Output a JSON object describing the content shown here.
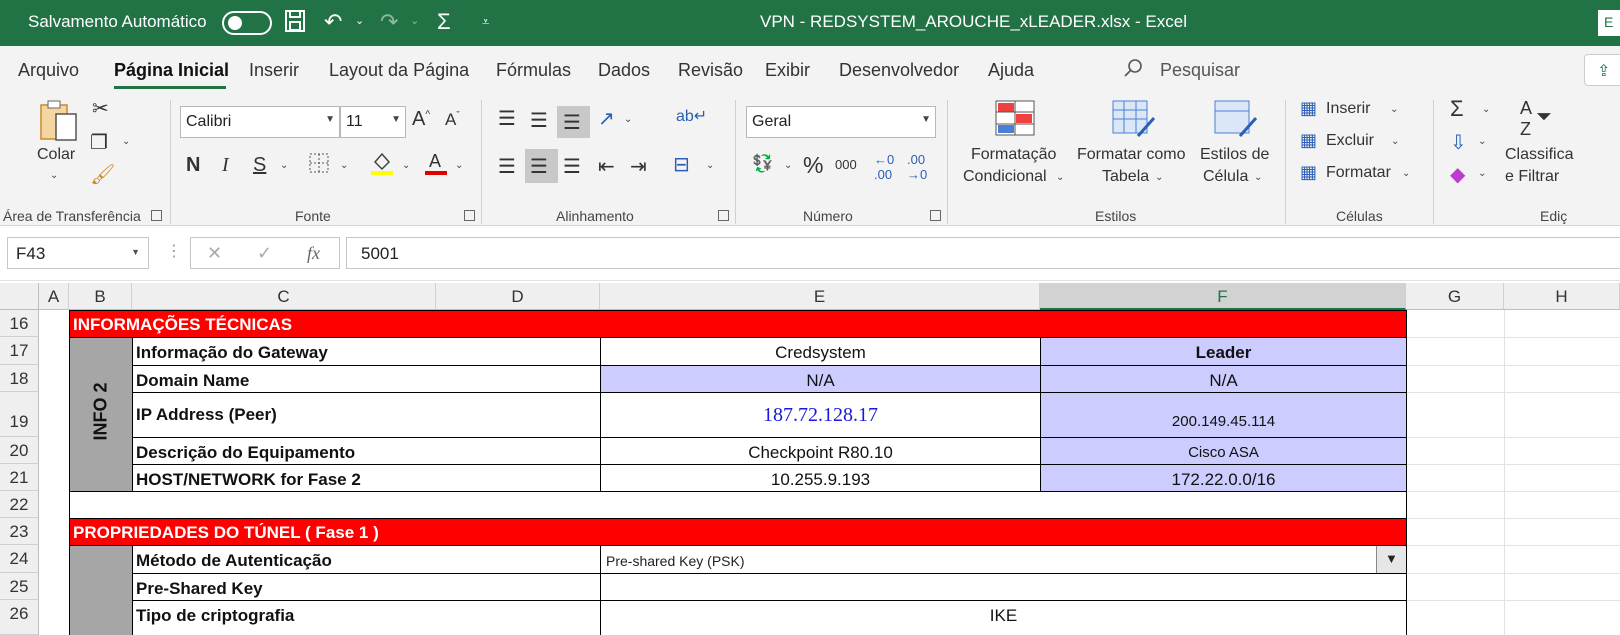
{
  "titlebar": {
    "autosave_label": "Salvamento Automático",
    "doc_title": "VPN  -  REDSYSTEM_AROUCHE_xLEADER.xlsx  -  Excel",
    "right_badge": "E"
  },
  "tabs": {
    "items": [
      "Arquivo",
      "Página Inicial",
      "Inserir",
      "Layout da Página",
      "Fórmulas",
      "Dados",
      "Revisão",
      "Exibir",
      "Desenvolvedor",
      "Ajuda"
    ],
    "search_label": "Pesquisar"
  },
  "ribbon": {
    "clipboard": {
      "paste_label": "Colar",
      "group_label": "Área de Transferência"
    },
    "font": {
      "font_name": "Calibri",
      "font_size": "11",
      "bold": "N",
      "italic": "I",
      "underline": "S",
      "group_label": "Fonte"
    },
    "alignment": {
      "group_label": "Alinhamento"
    },
    "number": {
      "format": "Geral",
      "group_label": "Número"
    },
    "styles": {
      "cond_format_line1": "Formatação",
      "cond_format_line2": "Condicional",
      "format_table_line1": "Formatar como",
      "format_table_line2": "Tabela",
      "cell_styles_line1": "Estilos de",
      "cell_styles_line2": "Célula",
      "group_label": "Estilos"
    },
    "cells": {
      "insert": "Inserir",
      "delete": "Excluir",
      "format": "Formatar",
      "group_label": "Células"
    },
    "editing": {
      "sort_line1": "Classifica",
      "sort_line2": "e Filtrar",
      "group_label": "Ediç"
    }
  },
  "formula_bar": {
    "cell_ref": "F43",
    "formula": "5001"
  },
  "grid": {
    "columns": [
      "A",
      "B",
      "C",
      "D",
      "E",
      "F",
      "G",
      "H"
    ],
    "selected_column": "F",
    "rows": [
      "16",
      "17",
      "18",
      "19",
      "20",
      "21",
      "22",
      "23",
      "24",
      "25",
      "26"
    ],
    "section1_title": "INFORMAÇÕES TÉCNICAS",
    "block_label": "INFO 2",
    "r17": {
      "label": "Informação do Gateway",
      "e": "Credsystem",
      "f": "Leader"
    },
    "r18": {
      "label": "Domain Name",
      "e": "N/A",
      "f": "N/A"
    },
    "r19": {
      "label": "IP Address (Peer)",
      "e": "187.72.128.17",
      "f": "200.149.45.114"
    },
    "r20": {
      "label": "Descrição do Equipamento",
      "e": "Checkpoint R80.10",
      "f": "Cisco ASA"
    },
    "r21": {
      "label": "HOST/NETWORK for Fase 2",
      "e": "10.255.9.193",
      "f": "172.22.0.0/16"
    },
    "section2_title": "PROPRIEDADES DO TÚNEL ( Fase 1 )",
    "r24": {
      "label": "Método de Autenticação",
      "value": "Pre-shared Key (PSK)"
    },
    "r25": {
      "label": "Pre-Shared Key",
      "value": ""
    },
    "r26": {
      "label": "Tipo de criptografia",
      "value": "IKE"
    }
  },
  "colors": {
    "excel_green": "#217346",
    "section_red": "#ff0000",
    "lavender": "#ccccff",
    "block_gray": "#a6a6a6"
  }
}
